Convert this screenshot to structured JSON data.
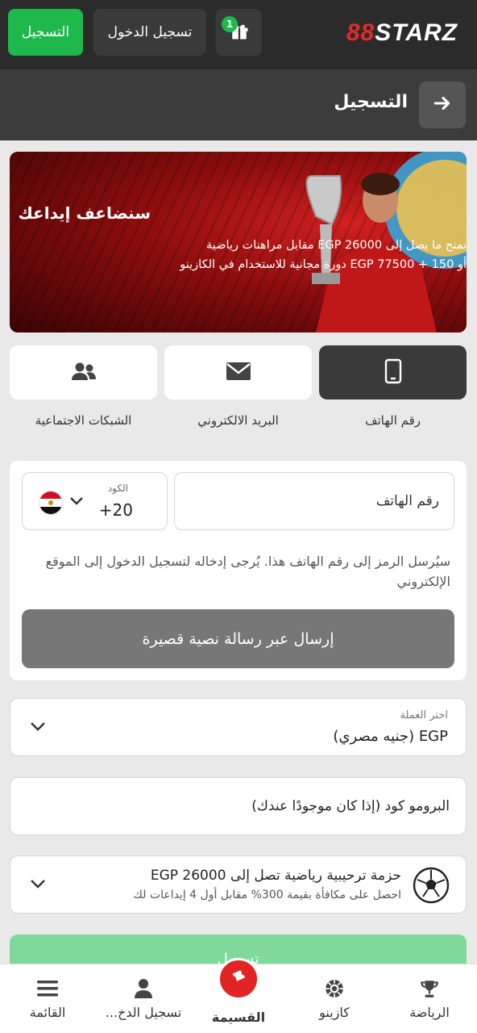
{
  "header": {
    "logo_prefix": "88",
    "logo_text": "STARZ",
    "register_label": "التسجيل",
    "login_label": "تسجيل الدخول",
    "gift_badge_count": "1"
  },
  "titlebar": {
    "title": "التسجيل"
  },
  "banner": {
    "headline": "سنضاعف إيداعك",
    "line1": "نمنح ما يصل إلى EGP 26000 مقابل مراهنات رياضية",
    "line2": "أو EGP 77500 + 150 دورة مجانية للاستخدام في الكازينو"
  },
  "methods": [
    {
      "label": "رقم الهاتف",
      "icon": "phone-icon",
      "active": true
    },
    {
      "label": "البريد الالكتروني",
      "icon": "envelope-icon",
      "active": false
    },
    {
      "label": "الشبكات الاجتماعية",
      "icon": "users-icon",
      "active": false
    }
  ],
  "phone_form": {
    "code_label": "الكود",
    "code_value": "+20",
    "country_flag": "egypt-flag",
    "phone_placeholder": "رقم الهاتف",
    "hint": "سيُرسل الرمز إلى رقم الهاتف هذا. يُرجى إدخاله لتسجيل الدخول إلى الموقع الإلكتروني",
    "sms_button": "إرسال عبر رسالة نصية قصيرة"
  },
  "currency": {
    "label": "اختر العملة",
    "value": "EGP  (جنيه مصري)"
  },
  "promo": {
    "placeholder": "البرومو كود (إذا كان موجودًا عندك)"
  },
  "bonus": {
    "title": "حزمة ترحيبية رياضية تصل إلى EGP 26000",
    "subtitle": "احصل على مكافأة بقيمة 300% مقابل أول 4 إيداعات لك",
    "icon": "soccer-ball-icon"
  },
  "submit_label": "تسجيل",
  "bottom_nav": [
    {
      "label": "الرياضة",
      "icon": "trophy-icon"
    },
    {
      "label": "كازينو",
      "icon": "casino-chip-icon"
    },
    {
      "label": "القسيمة",
      "icon": "ticket-icon"
    },
    {
      "label": "تسجيل الدخ...",
      "icon": "user-icon"
    },
    {
      "label": "القائمة",
      "icon": "menu-icon"
    }
  ],
  "colors": {
    "brand_green": "#1fb84a",
    "brand_red": "#e32b2b",
    "dark_bg": "#2b2b2b"
  }
}
